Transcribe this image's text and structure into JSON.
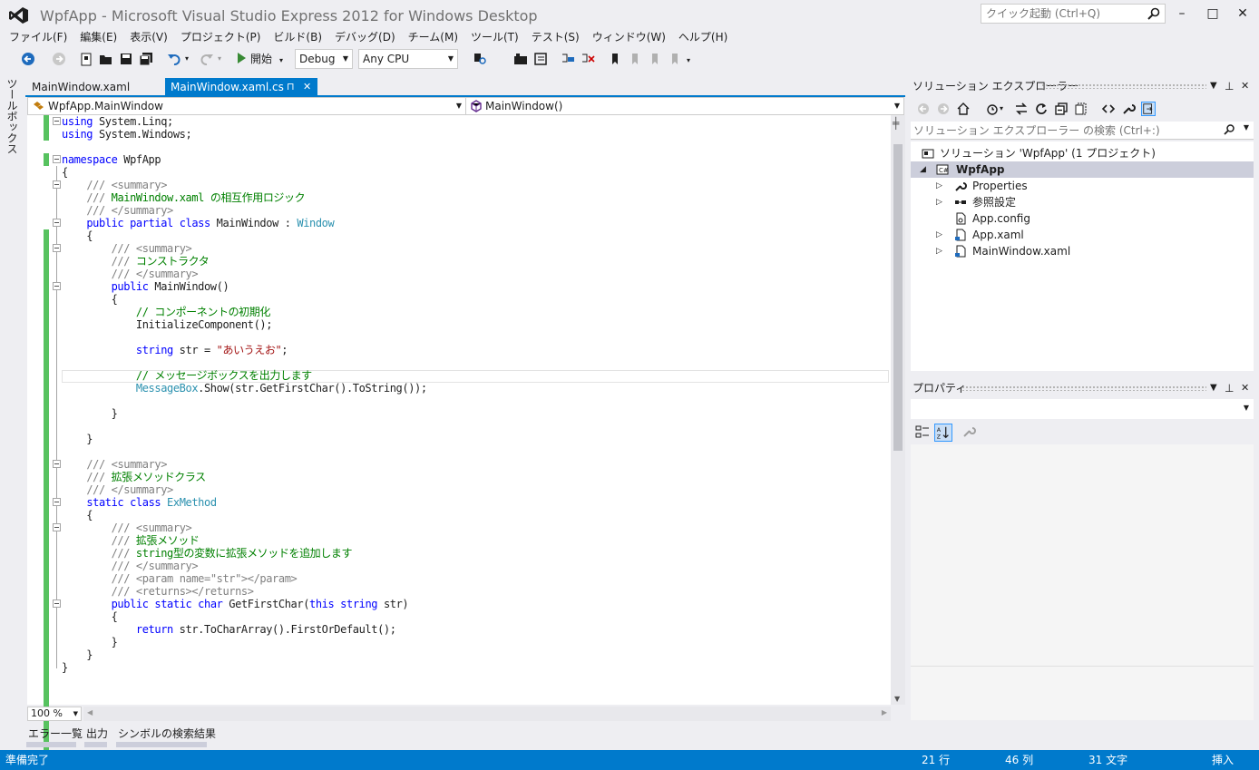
{
  "window": {
    "title": "WpfApp - Microsoft Visual Studio Express 2012 for Windows Desktop",
    "quick_launch_placeholder": "クイック起動 (Ctrl+Q)",
    "minimize": "–",
    "maximize": "□",
    "close": "✕"
  },
  "menu": [
    "ファイル(F)",
    "編集(E)",
    "表示(V)",
    "プロジェクト(P)",
    "ビルド(B)",
    "デバッグ(D)",
    "チーム(M)",
    "ツール(T)",
    "テスト(S)",
    "ウィンドウ(W)",
    "ヘルプ(H)"
  ],
  "toolbar": {
    "start_label": "開始",
    "config": "Debug",
    "platform": "Any CPU"
  },
  "toolbox_label": "ツールボックス",
  "tabs": [
    {
      "label": "MainWindow.xaml",
      "active": false
    },
    {
      "label": "MainWindow.xaml.cs",
      "active": true
    }
  ],
  "tab_pin": "⊓",
  "tab_close": "✕",
  "navbar": {
    "type": "WpfApp.MainWindow",
    "member": "MainWindow()"
  },
  "code_lines": [
    "using System.Linq;",
    "using System.Windows;",
    "",
    "namespace WpfApp",
    "{",
    "    /// <summary>",
    "    /// MainWindow.xaml の相互作用ロジック",
    "    /// </summary>",
    "    public partial class MainWindow : Window",
    "    {",
    "        /// <summary>",
    "        /// コンストラクタ",
    "        /// </summary>",
    "        public MainWindow()",
    "        {",
    "            // コンポーネントの初期化",
    "            InitializeComponent();",
    "",
    "            string str = \"あいうえお\";",
    "",
    "            // メッセージボックスを出力します",
    "            MessageBox.Show(str.GetFirstChar().ToString());",
    "",
    "        }",
    "",
    "    }",
    "",
    "    /// <summary>",
    "    /// 拡張メソッドクラス",
    "    /// </summary>",
    "    static class ExMethod",
    "    {",
    "        /// <summary>",
    "        /// 拡張メソッド",
    "        /// string型の変数に拡張メソッドを追加します",
    "        /// </summary>",
    "        /// <param name=\"str\"></param>",
    "        /// <returns></returns>",
    "        public static char GetFirstChar(this string str)",
    "        {",
    "            return str.ToCharArray().FirstOrDefault();",
    "        }",
    "    }",
    "}"
  ],
  "zoom": "100 %",
  "bottom_tabs": [
    "エラー一覧",
    "出力",
    "シンボルの検索結果"
  ],
  "status": {
    "ready": "準備完了",
    "line": "21 行",
    "col": "46 列",
    "char": "31 文字",
    "mode": "挿入"
  },
  "solution_explorer": {
    "title": "ソリューション エクスプローラー",
    "search_placeholder": "ソリューション エクスプローラー の検索 (Ctrl+:)",
    "items": [
      {
        "label": "ソリューション 'WpfApp' (1 プロジェクト)",
        "bold": false
      },
      {
        "label": "WpfApp",
        "bold": true
      },
      {
        "label": "Properties",
        "bold": false
      },
      {
        "label": "参照設定",
        "bold": false
      },
      {
        "label": "App.config",
        "bold": false
      },
      {
        "label": "App.xaml",
        "bold": false
      },
      {
        "label": "MainWindow.xaml",
        "bold": false
      }
    ]
  },
  "properties": {
    "title": "プロパティ"
  },
  "colors": {
    "accent": "#007acc",
    "change_bar": "#57c25f",
    "keyword": "#0000ff",
    "type": "#2b91af",
    "comment": "#008000",
    "string": "#a31515"
  }
}
